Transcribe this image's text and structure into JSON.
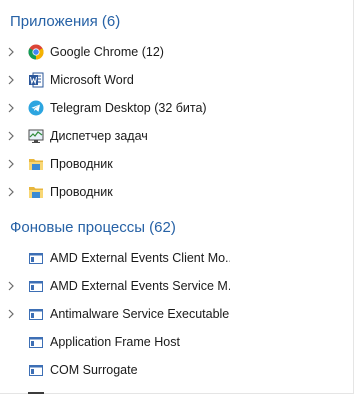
{
  "apps_section": {
    "title": "Приложения (6)",
    "items": [
      {
        "label": "Google Chrome (12)",
        "icon": "chrome-icon",
        "expandable": true
      },
      {
        "label": "Microsoft Word",
        "icon": "word-icon",
        "expandable": true
      },
      {
        "label": "Telegram Desktop (32 бита)",
        "icon": "telegram-icon",
        "expandable": true
      },
      {
        "label": "Диспетчер задач",
        "icon": "task-manager-icon",
        "expandable": true
      },
      {
        "label": "Проводник",
        "icon": "explorer-folder-icon",
        "expandable": true
      },
      {
        "label": "Проводник",
        "icon": "explorer-folder-icon",
        "expandable": true
      }
    ]
  },
  "background_section": {
    "title": "Фоновые процессы (62)",
    "items": [
      {
        "label": "AMD External Events Client Mo...",
        "icon": "service-window-icon",
        "expandable": false
      },
      {
        "label": "AMD External Events Service M...",
        "icon": "service-window-icon",
        "expandable": true
      },
      {
        "label": "Antimalware Service Executable",
        "icon": "service-window-icon",
        "expandable": true
      },
      {
        "label": "Application Frame Host",
        "icon": "service-window-icon",
        "expandable": false
      },
      {
        "label": "COM Surrogate",
        "icon": "service-window-icon",
        "expandable": false
      }
    ]
  },
  "colors": {
    "section_header": "#2762a6",
    "chevron": "#6b6b6b",
    "text": "#1a1a1a"
  }
}
